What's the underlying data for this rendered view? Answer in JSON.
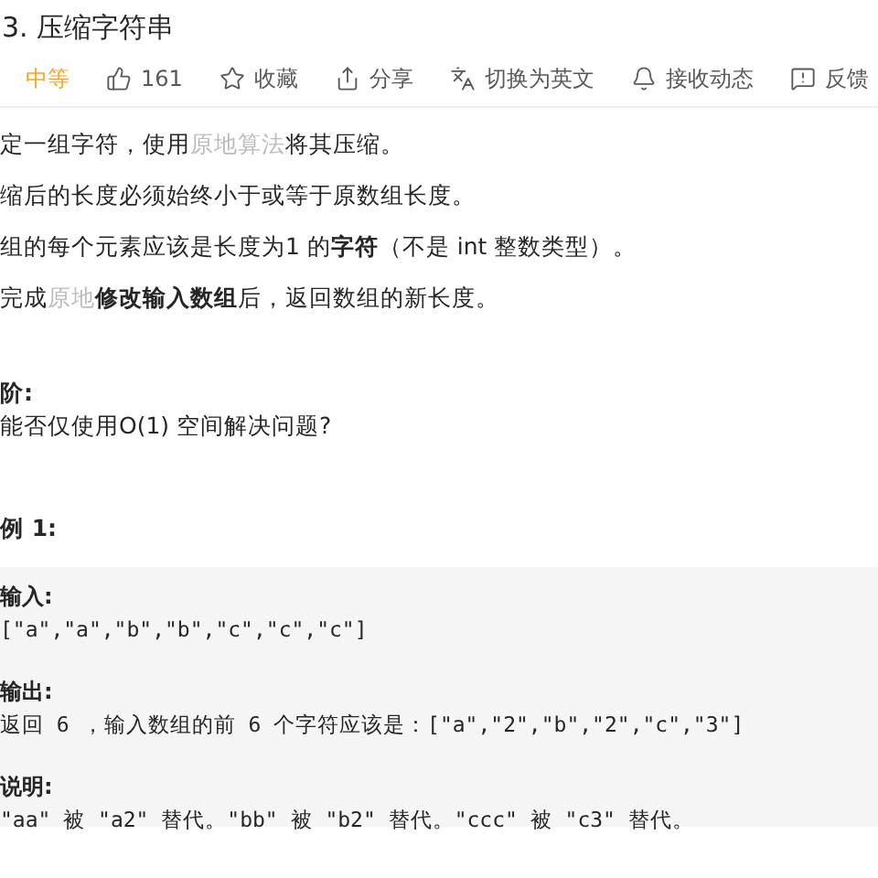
{
  "title": "3. 压缩字符串",
  "toolbar": [
    {
      "kind": "difficulty",
      "label": "中等"
    },
    {
      "kind": "like",
      "label": "161"
    },
    {
      "kind": "star",
      "label": "收藏"
    },
    {
      "kind": "share",
      "label": "分享"
    },
    {
      "kind": "translate",
      "label": "切换为英文"
    },
    {
      "kind": "bell",
      "label": "接收动态"
    },
    {
      "kind": "feedback",
      "label": "反馈"
    }
  ],
  "paragraphs": [
    [
      {
        "kind": "plain",
        "text": "定一组字符，使用"
      },
      {
        "kind": "link",
        "text": "原地算法"
      },
      {
        "kind": "plain",
        "text": "将其压缩。"
      }
    ],
    [
      {
        "kind": "plain",
        "text": "缩后的长度必须始终小于或等于原数组长度。"
      }
    ],
    [
      {
        "kind": "plain",
        "text": "组的每个元素应该是长度为1 的"
      },
      {
        "kind": "bold",
        "text": "字符"
      },
      {
        "kind": "plain",
        "text": "（不是 int 整数类型）。"
      }
    ],
    [
      {
        "kind": "plain",
        "text": "完成"
      },
      {
        "kind": "link",
        "text": "原地"
      },
      {
        "kind": "bold",
        "text": "修改输入数组"
      },
      {
        "kind": "plain",
        "text": "后，返回数组的新长度。"
      }
    ]
  ],
  "advanced": {
    "heading": "阶:",
    "text": "能否仅使用O(1) 空间解决问题?"
  },
  "example": {
    "heading": "例 1:",
    "blocks": [
      {
        "label": "输入:",
        "code": "[\"a\",\"a\",\"b\",\"b\",\"c\",\"c\",\"c\"]"
      },
      {
        "label": "输出:",
        "code": "返回 6 ，输入数组的前 6 个字符应该是：[\"a\",\"2\",\"b\",\"2\",\"c\",\"3\"]"
      },
      {
        "label": "说明:",
        "code": "\"aa\" 被 \"a2\" 替代。\"bb\" 被 \"b2\" 替代。\"ccc\" 被 \"c3\" 替代。"
      }
    ]
  }
}
